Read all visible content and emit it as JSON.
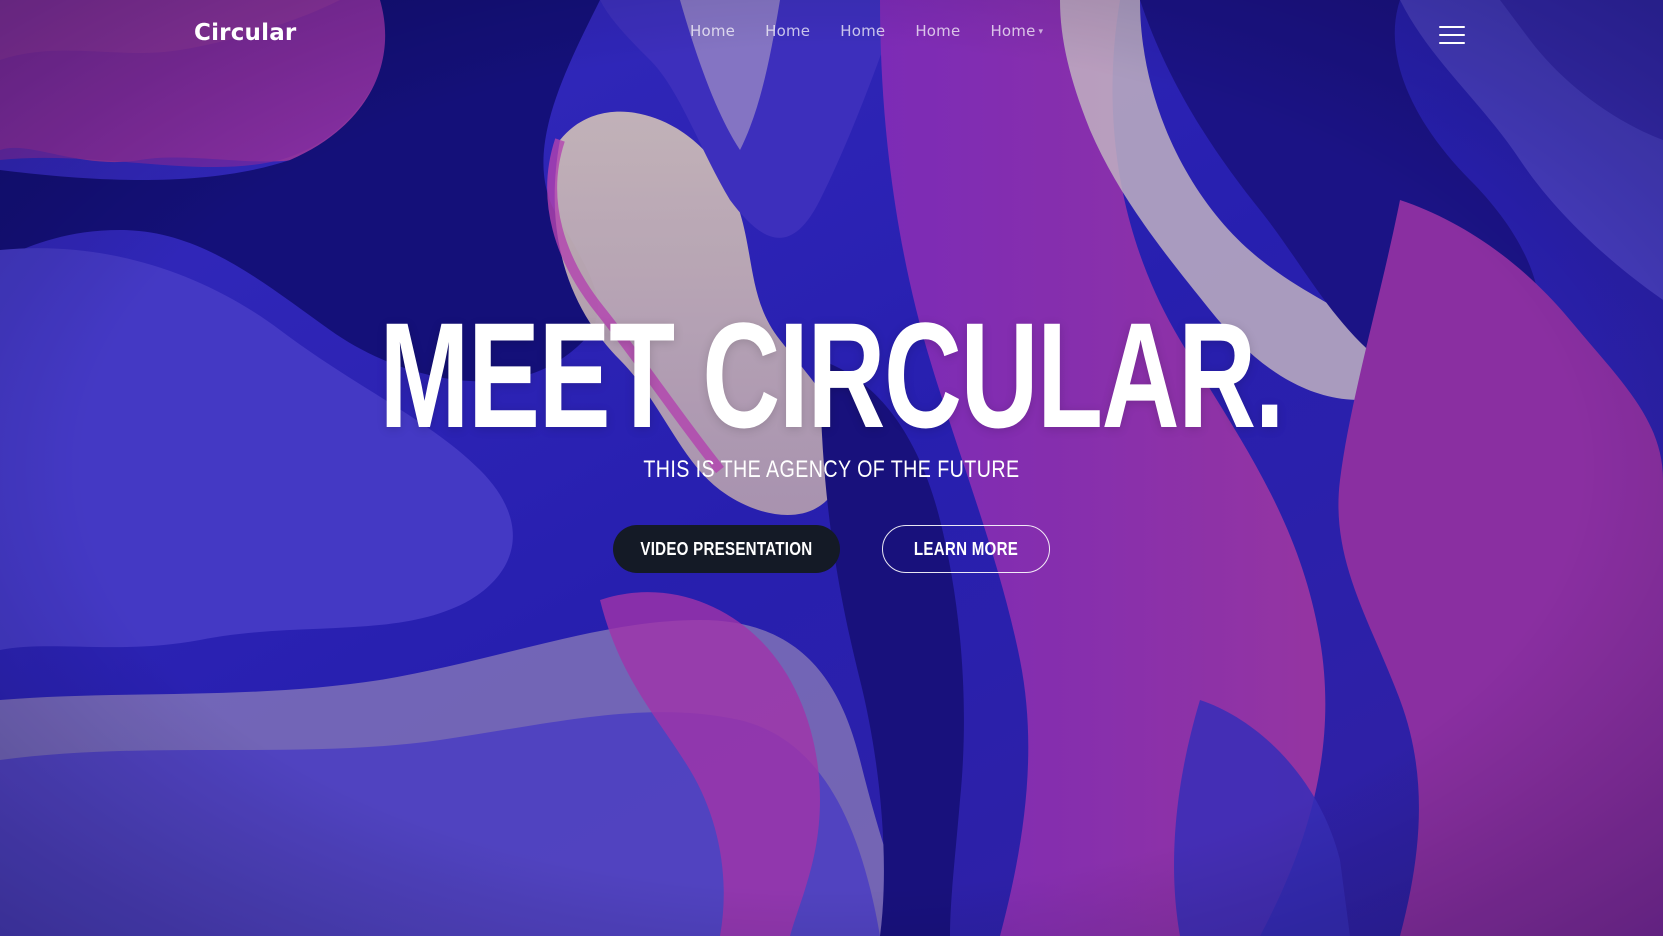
{
  "brand": {
    "name": "Circular"
  },
  "nav": {
    "items": [
      {
        "label": "Home"
      },
      {
        "label": "Home"
      },
      {
        "label": "Home"
      },
      {
        "label": "Home"
      },
      {
        "label": "Home",
        "has_dropdown": true
      }
    ],
    "menu_icon": "hamburger-icon"
  },
  "hero": {
    "title": "MEET CIRCULAR.",
    "subtitle": "THIS IS THE AGENCY OF THE FUTURE",
    "primary_button": "VIDEO PRESENTATION",
    "secondary_button": "LEARN MORE"
  },
  "colors": {
    "primary_button_bg": "#141a26",
    "text": "#ffffff",
    "background_blue": "#3a2fc4",
    "background_magenta": "#9b2fb8"
  }
}
